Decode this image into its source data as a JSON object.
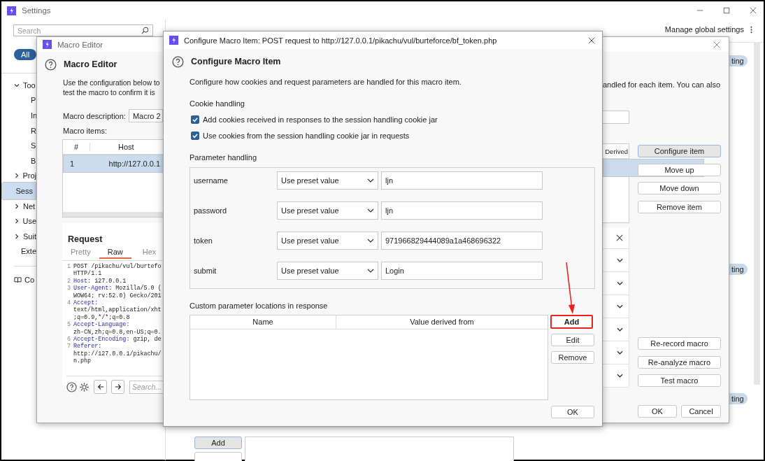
{
  "settings_window": {
    "title": "Settings",
    "search": {
      "placeholder": "Search"
    },
    "filter": {
      "label": "All",
      "selected": true
    },
    "sidebar": {
      "items": [
        {
          "label": "Too",
          "expanded": true,
          "selected": false,
          "children": [
            {
              "label": "P",
              "selected": false
            },
            {
              "label": "In",
              "selected": false
            },
            {
              "label": "R",
              "selected": false
            },
            {
              "label": "S",
              "selected": false
            },
            {
              "label": "B",
              "selected": false
            }
          ]
        },
        {
          "label": "Proj",
          "expanded": false,
          "selected": false
        },
        {
          "label": "Sess",
          "selected": true
        },
        {
          "label": "Net",
          "expanded": false,
          "selected": false
        },
        {
          "label": "Use",
          "expanded": false,
          "selected": false
        },
        {
          "label": "Suit",
          "expanded": false,
          "selected": false
        },
        {
          "label": "Exte",
          "selected": false
        }
      ],
      "footer_link": "Co"
    },
    "manage_link": "Manage global settings",
    "badges": [
      "ting",
      "ting",
      "ting"
    ],
    "bottom_buttons": [
      "Add"
    ]
  },
  "macro_editor": {
    "title": "Macro Editor",
    "heading": "Macro Editor",
    "description_left": [
      "Use the configuration below to",
      "test the macro to confirm it is"
    ],
    "description_right": "andled for each item. You can also",
    "macro_description": {
      "label": "Macro description:",
      "value": "Macro 2"
    },
    "macro_items": {
      "label": "Macro items:",
      "columns": [
        "#",
        "Host",
        "Derived"
      ],
      "rows": [
        {
          "number": "1",
          "host": "http://127.0.0.1",
          "selected": true
        }
      ]
    },
    "request": {
      "title": "Request",
      "tabs": [
        {
          "label": "Pretty",
          "selected": false
        },
        {
          "label": "Raw",
          "selected": true
        },
        {
          "label": "Hex",
          "selected": false
        }
      ],
      "lines": [
        {
          "number": "1",
          "value": "POST /pikachu/vul/burtefo"
        },
        {
          "value": "HTTP/1.1"
        },
        {
          "number": "2",
          "header": "Host",
          "value": ": 127.0.0.1"
        },
        {
          "number": "3",
          "header": "User-Agent",
          "value": ": Mozilla/5.0 ("
        },
        {
          "value": "WOW64; rv:52.0) Gecko/201"
        },
        {
          "number": "4",
          "header": "Accept",
          "value": ":"
        },
        {
          "value": "text/html,application/xht"
        },
        {
          "value": ";q=0.9,*/*;q=0.8"
        },
        {
          "number": "5",
          "header": "Accept-Language",
          "value": ":"
        },
        {
          "value": "zh-CN,zh;q=0.8,en-US;q=0."
        },
        {
          "number": "6",
          "header": "Accept-Encoding",
          "value": ": gzip, de"
        },
        {
          "number": "7",
          "header": "Referer",
          "value": ":"
        },
        {
          "value": "http://127.0.0.1/pikachu/"
        },
        {
          "value": "n.php"
        }
      ],
      "search": {
        "placeholder": "Search..."
      }
    },
    "item_buttons": [
      {
        "label": "Configure item",
        "focused": true
      },
      {
        "label": "Move up",
        "focused": false
      },
      {
        "label": "Move down",
        "focused": false
      },
      {
        "label": "Remove item",
        "focused": false
      }
    ],
    "macro_buttons": [
      "Re-record macro",
      "Re-analyze macro",
      "Test macro"
    ],
    "footer_buttons": [
      "OK",
      "Cancel"
    ]
  },
  "configure_dialog": {
    "title": "Configure Macro Item: POST request to http://127.0.0.1/pikachu/vul/burteforce/bf_token.php",
    "heading": "Configure Macro Item",
    "description": "Configure how cookies and request parameters are handled for this macro item.",
    "cookie_handling": {
      "label": "Cookie handling",
      "options": [
        {
          "label": "Add cookies received in responses to the session handling cookie jar",
          "checked": true
        },
        {
          "label": "Use cookies from the session handling cookie jar in requests",
          "checked": true
        }
      ]
    },
    "parameter_handling": {
      "label": "Parameter handling",
      "params": [
        {
          "name": "username",
          "mode": "Use preset value",
          "value": "ljn"
        },
        {
          "name": "password",
          "mode": "Use preset value",
          "value": "ljn"
        },
        {
          "name": "token",
          "mode": "Use preset value",
          "value": "971966829444089a1a468696322"
        },
        {
          "name": "submit",
          "mode": "Use preset value",
          "value": "Login"
        }
      ]
    },
    "custom_locations": {
      "label": "Custom parameter locations in response",
      "columns": [
        "Name",
        "Value derived from"
      ],
      "buttons": [
        {
          "label": "Add",
          "highlighted": true
        },
        {
          "label": "Edit",
          "highlighted": false
        },
        {
          "label": "Remove",
          "highlighted": false
        }
      ]
    },
    "ok_button": "OK"
  }
}
